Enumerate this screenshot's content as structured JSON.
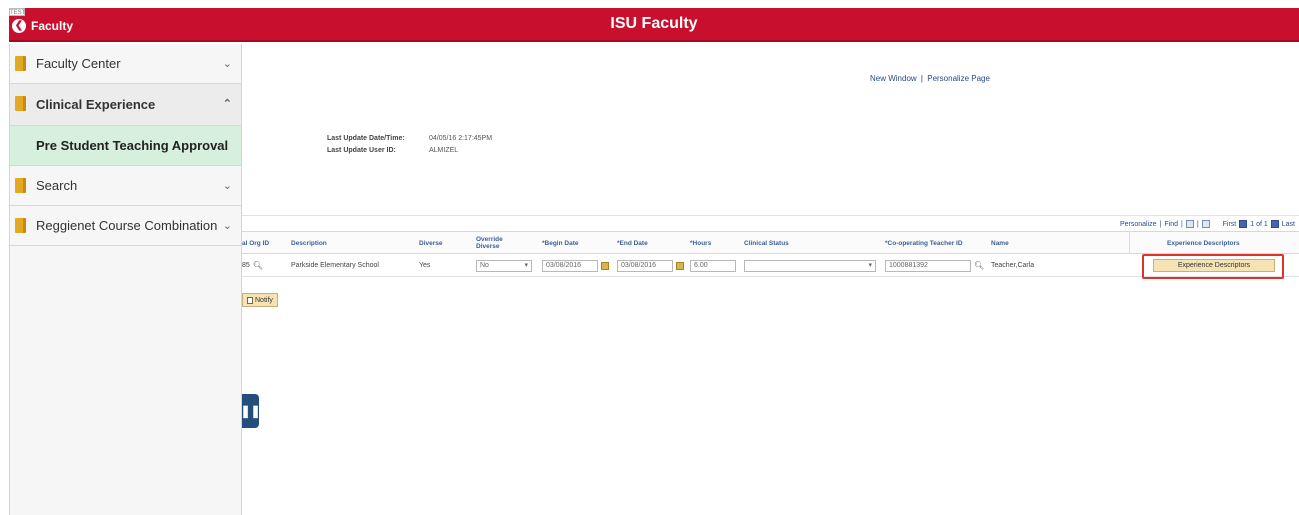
{
  "header": {
    "back_label": "Faculty",
    "title": "ISU Faculty",
    "badge": "TEST"
  },
  "sidebar": {
    "items": [
      {
        "label": "Faculty Center",
        "chevron": "⌄"
      },
      {
        "label": "Clinical Experience",
        "chevron": "⌃"
      },
      {
        "label": "Search",
        "chevron": "⌄"
      },
      {
        "label": "Reggienet Course Combination",
        "chevron": "⌄"
      }
    ],
    "sub_item": "Pre Student Teaching Approval"
  },
  "links": {
    "new_window": "New Window",
    "sep": "|",
    "personalize_page": "Personalize Page"
  },
  "update_info": {
    "date_label": "Last Update Date/Time:",
    "date_value": "04/05/16  2:17:45PM",
    "user_label": "Last Update User ID:",
    "user_value": "ALMIZEL"
  },
  "grid_nav": {
    "personalize": "Personalize",
    "find": "Find",
    "first": "First",
    "range": "1 of 1",
    "last": "Last"
  },
  "grid": {
    "headers": {
      "org_id": "al Org ID",
      "description": "Description",
      "diverse": "Diverse",
      "override_diverse": "Override Diverse",
      "begin_date": "*Begin Date",
      "end_date": "*End Date",
      "hours": "*Hours",
      "clinical_status": "Clinical Status",
      "coop_teacher_id": "*Co-operating Teacher ID",
      "name": "Name",
      "experience_descriptors": "Experience Descriptors"
    },
    "row": {
      "org_id": "85",
      "description": "Parkside Elementary School",
      "diverse": "Yes",
      "override_diverse": "No",
      "begin_date": "03/08/2016",
      "end_date": "03/08/2016",
      "hours": "6.00",
      "clinical_status": "",
      "coop_teacher_id": "1000881392",
      "name": "Teacher,Carla",
      "experience_button": "Experience Descriptors"
    }
  },
  "actions": {
    "notify": "Notify"
  },
  "colors": {
    "brand_red": "#c8102e",
    "sidebar_selected": "#d6f0dd",
    "highlight_box": "#e0312b"
  }
}
